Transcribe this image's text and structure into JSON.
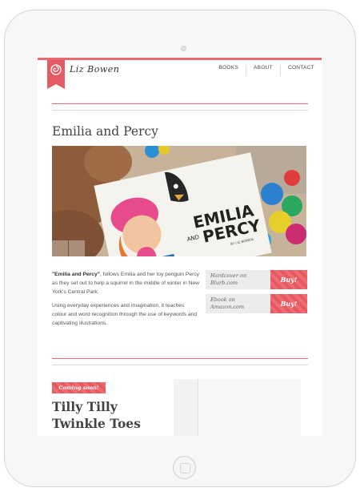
{
  "brand": {
    "signature": "Liz Bowen"
  },
  "nav": {
    "items": [
      "BOOKS",
      "ABOUT",
      "CONTACT"
    ]
  },
  "book1": {
    "title": "Emilia and Percy",
    "cover_title_line1": "EMILIA",
    "cover_title_line2": "PERCY",
    "cover_and": "AND",
    "cover_byline": "BY LIZ BOWEN",
    "desc_bold": "\"Emilia and Percy\"",
    "desc_p1_rest": ", follows Emilia and her toy penguin Percy as they set out to help a squirrel in the middle of winter in New York's Central Park.",
    "desc_p2": "Using everyday experiences and imagination, it teaches colour and word recognition through the use of keywords and captivating illustrations.",
    "buy_options": [
      {
        "line1": "Hardcover on",
        "line2": "Blurb.com",
        "button": "Buy!"
      },
      {
        "line1": "Ebook on",
        "line2": "Amazon.com",
        "button": "Buy!"
      }
    ]
  },
  "book2": {
    "badge": "Coming soon!",
    "title_line1": "Tilly Tilly",
    "title_line2": "Twinkle Toes"
  },
  "colors": {
    "accent": "#e8686f",
    "text": "#444444"
  }
}
